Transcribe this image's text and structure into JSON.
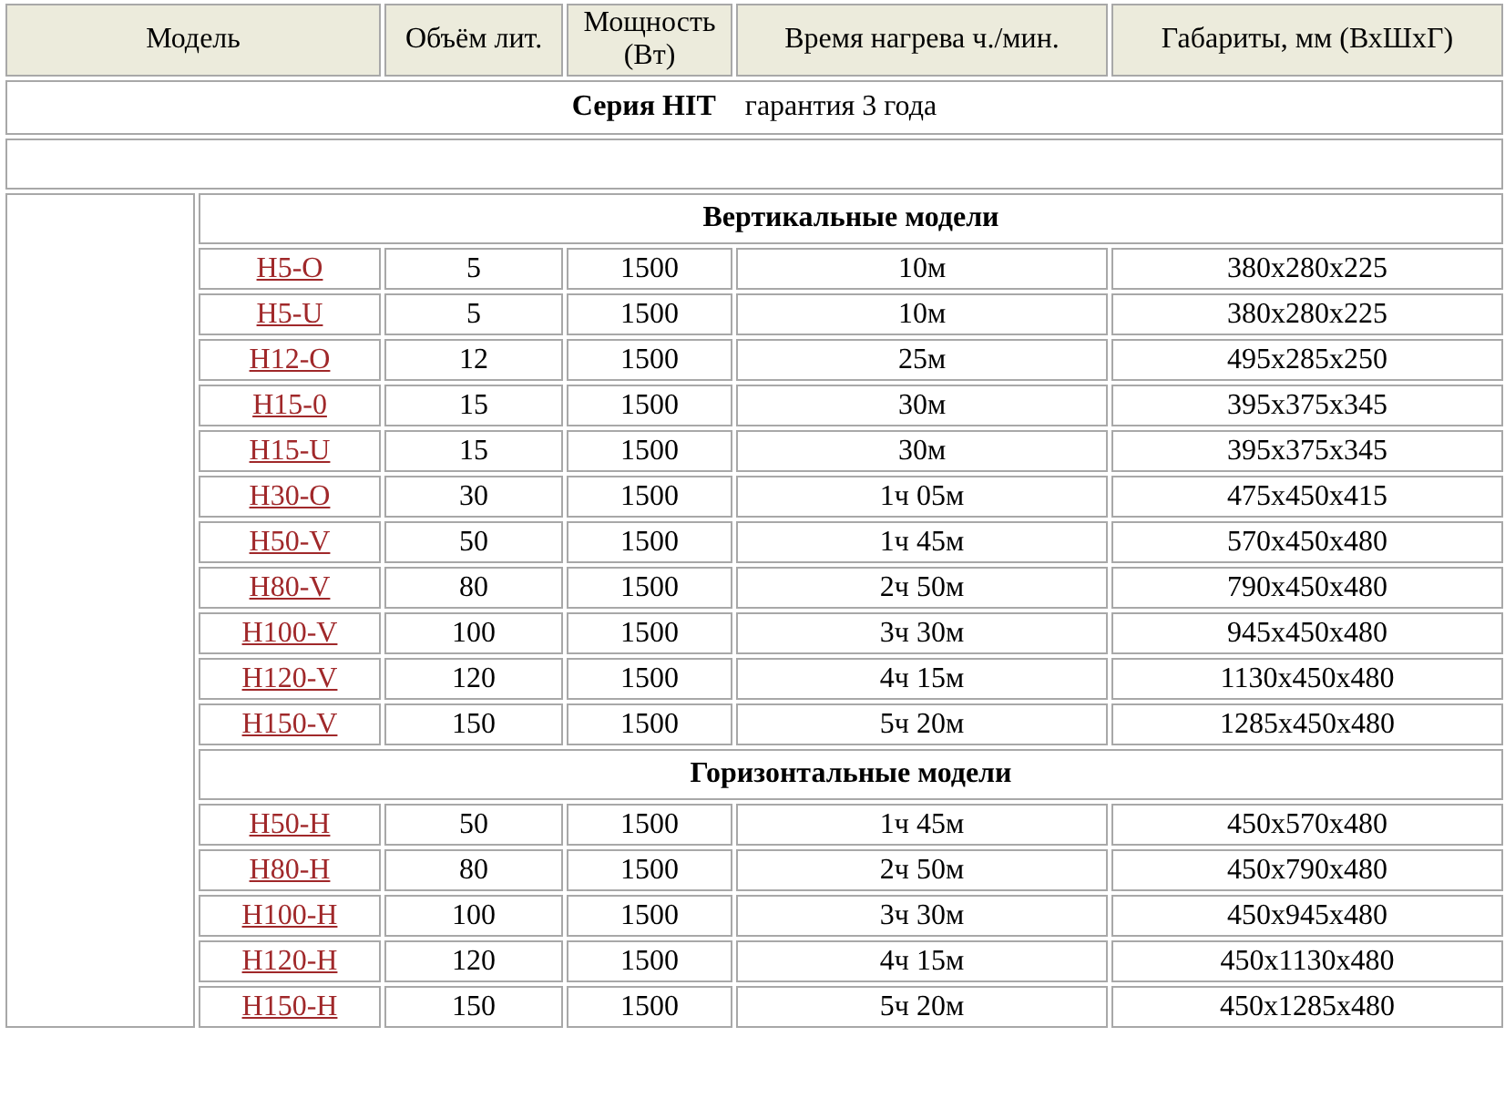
{
  "columns": [
    "Модель",
    "Объём лит.",
    "Мощность (Вт)",
    "Время нагрева ч./мин.",
    "Габариты, мм (ВхШхГ)"
  ],
  "series": "**Серия HIT**    гарантия 3 года",
  "groups": [
    {
      "title": "Вертикальные модели",
      "rows": [
        {
          "model": "H5-O",
          "volume": "5",
          "power": "1500",
          "time": "10м",
          "dims": "380x280x225"
        },
        {
          "model": "H5-U",
          "volume": "5",
          "power": "1500",
          "time": "10м",
          "dims": "380x280x225"
        },
        {
          "model": "H12-O",
          "volume": "12",
          "power": "1500",
          "time": "25м",
          "dims": "495x285x250"
        },
        {
          "model": "H15-0",
          "volume": "15",
          "power": "1500",
          "time": "30м",
          "dims": "395x375x345"
        },
        {
          "model": "H15-U",
          "volume": "15",
          "power": "1500",
          "time": "30м",
          "dims": "395x375x345"
        },
        {
          "model": "H30-O",
          "volume": "30",
          "power": "1500",
          "time": "1ч 05м",
          "dims": "475x450x415"
        },
        {
          "model": "H50-V",
          "volume": "50",
          "power": "1500",
          "time": "1ч 45м",
          "dims": "570x450x480"
        },
        {
          "model": "H80-V",
          "volume": "80",
          "power": "1500",
          "time": "2ч 50м",
          "dims": "790x450x480"
        },
        {
          "model": "H100-V",
          "volume": "100",
          "power": "1500",
          "time": "3ч 30м",
          "dims": "945x450x480"
        },
        {
          "model": "H120-V",
          "volume": "120",
          "power": "1500",
          "time": "4ч 15м",
          "dims": "1130x450x480"
        },
        {
          "model": "H150-V",
          "volume": "150",
          "power": "1500",
          "time": "5ч 20м",
          "dims": "1285x450x480"
        }
      ]
    },
    {
      "title": "Горизонтальные модели",
      "rows": [
        {
          "model": "H50-H",
          "volume": "50",
          "power": "1500",
          "time": "1ч 45м",
          "dims": "450x570x480"
        },
        {
          "model": "H80-H",
          "volume": "80",
          "power": "1500",
          "time": "2ч 50м",
          "dims": "450x790x480"
        },
        {
          "model": "H100-H",
          "volume": "100",
          "power": "1500",
          "time": "3ч 30м",
          "dims": "450x945x480"
        },
        {
          "model": "H120-H",
          "volume": "120",
          "power": "1500",
          "time": "4ч 15м",
          "dims": "450x1130x480"
        },
        {
          "model": "H150-H",
          "volume": "150",
          "power": "1500",
          "time": "5ч 20м",
          "dims": "450x1285x480"
        }
      ]
    }
  ]
}
